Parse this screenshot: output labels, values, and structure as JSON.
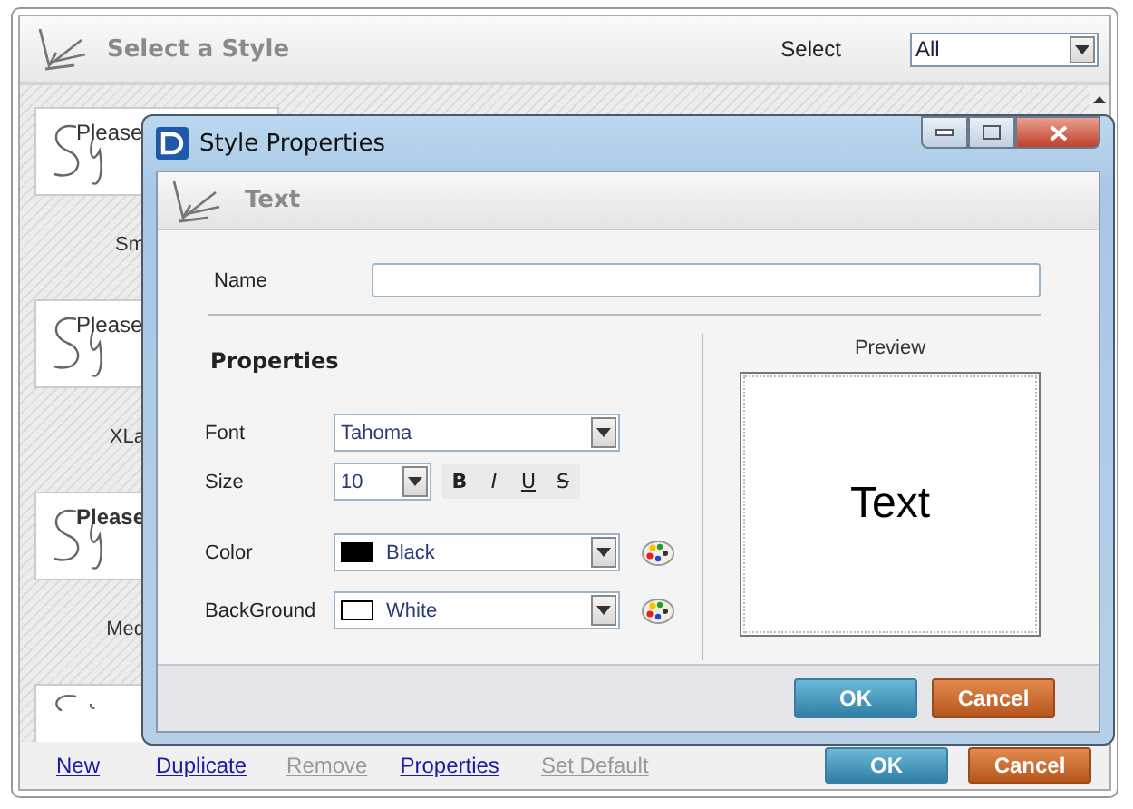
{
  "window": {
    "title": "Select a Style",
    "filter_label": "Select",
    "filter": {
      "value": "All"
    }
  },
  "styles": [
    {
      "preview_text": "Please",
      "bold": false,
      "label": "Sm"
    },
    {
      "preview_text": "Please",
      "bold": false,
      "label": "XLa"
    },
    {
      "preview_text": "Please",
      "bold": true,
      "label": "Med"
    },
    {
      "kind": "partial"
    }
  ],
  "actions": [
    {
      "label": "New",
      "disabled": false
    },
    {
      "label": "Duplicate",
      "disabled": false
    },
    {
      "label": "Remove",
      "disabled": true
    },
    {
      "label": "Properties",
      "disabled": false
    },
    {
      "label": "Set Default",
      "disabled": true
    }
  ],
  "buttons": [
    {
      "label": "OK",
      "kind": "primary"
    },
    {
      "label": "Cancel",
      "kind": "secondary"
    }
  ],
  "dialog": {
    "title": "Style Properties",
    "header": "Text",
    "name": {
      "label": "Name"
    },
    "section": "Properties",
    "font": {
      "label": "Font",
      "value": "Tahoma"
    },
    "size": {
      "label": "Size",
      "value": "10"
    },
    "format_buttons": [
      {
        "label": "B",
        "kind": "bold",
        "on": false
      },
      {
        "label": "I",
        "kind": "italic",
        "on": false
      },
      {
        "label": "U",
        "kind": "underline",
        "on": false
      },
      {
        "label": "S",
        "kind": "strike",
        "on": false
      }
    ],
    "color": {
      "label": "Color",
      "value": "Black",
      "color": "#000000"
    },
    "background": {
      "label": "BackGround",
      "value": "White",
      "color": "#ffffff"
    },
    "preview": {
      "label": "Preview",
      "text": "Text"
    },
    "buttons": [
      {
        "label": "OK",
        "kind": "primary"
      },
      {
        "label": "Cancel",
        "kind": "secondary"
      }
    ]
  }
}
